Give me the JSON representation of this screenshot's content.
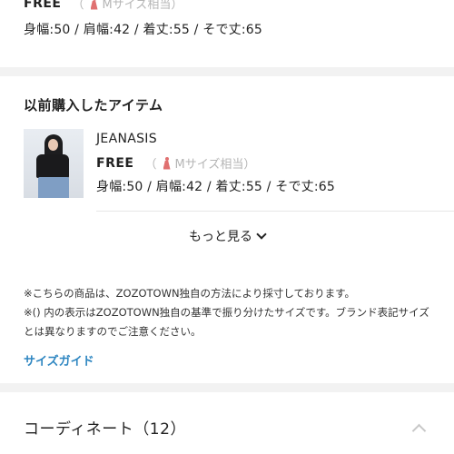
{
  "current_size": {
    "size_label": "FREE",
    "hint_open": "（",
    "hint_text": "Mサイズ相当）",
    "measurements": "身幅:50 / 肩幅:42 / 着丈:55 / そで丈:65"
  },
  "previous_purchase": {
    "title": "以前購入したアイテム",
    "item": {
      "brand": "JEANASIS",
      "size_label": "FREE",
      "hint_open": "（",
      "hint_text": "Mサイズ相当）",
      "measurements": "身幅:50 / 肩幅:42 / 着丈:55 / そで丈:65"
    },
    "more_label": "もっと見る"
  },
  "notes": {
    "note1": "※こちらの商品は、ZOZOTOWN独自の方法により採寸しております。",
    "note2": "※() 内の表示はZOZOTOWN独自の基準で振り分けたサイズです。ブランド表記サイズとは異なりますのでご注意ください。",
    "size_guide": "サイズガイド"
  },
  "coordinate": {
    "title": "コーディネート（12）"
  },
  "icons": {
    "hanger": "hanger-icon",
    "more": "chevron-down-icon",
    "collapse": "chevron-up-icon"
  },
  "colors": {
    "link": "#2e86c1",
    "hint": "#b5b5b5",
    "hanger": "#e07070"
  }
}
